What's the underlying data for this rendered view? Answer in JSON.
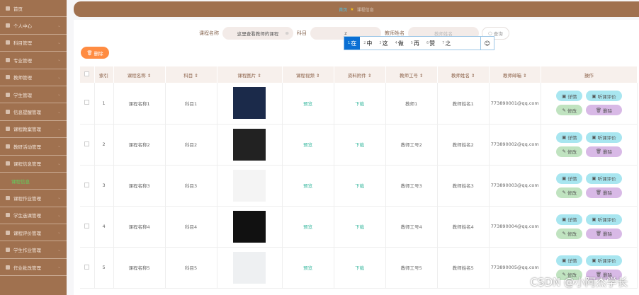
{
  "sidebar": {
    "items": [
      {
        "label": "首页"
      },
      {
        "label": "个人中心"
      },
      {
        "label": "科目管理"
      },
      {
        "label": "专业管理"
      },
      {
        "label": "教师管理"
      },
      {
        "label": "学生管理"
      },
      {
        "label": "信息提醒管理"
      },
      {
        "label": "课程教案管理"
      },
      {
        "label": "教研活动管理"
      },
      {
        "label": "课程信息管理"
      },
      {
        "label": "课程信息",
        "sub": true
      },
      {
        "label": "课程作业管理"
      },
      {
        "label": "学生选课管理"
      },
      {
        "label": "课程评价管理"
      },
      {
        "label": "学生作业管理"
      },
      {
        "label": "作业批改管理"
      }
    ]
  },
  "breadcrumb": {
    "home": "首页",
    "current": "课程信息"
  },
  "search": {
    "course_label": "课程名称",
    "course_value": "这里查看教师的课程",
    "subject_label": "科目",
    "subject_value": "z",
    "teacher_label": "教师姓名",
    "teacher_placeholder": "教师姓名",
    "query": "查询"
  },
  "ime": {
    "candidates": [
      "在",
      "中",
      "这",
      "做",
      "再",
      "赞",
      "之"
    ],
    "emoji": "☺"
  },
  "toolbar": {
    "delete": "删除"
  },
  "table": {
    "headers": [
      "索引",
      "课程名称",
      "科目",
      "课程图片",
      "课程视频",
      "资料附件",
      "教师工号",
      "教师姓名",
      "教师邮箱",
      "操作"
    ],
    "rows": [
      {
        "index": "1",
        "name": "课程名称1",
        "subject": "科目1",
        "video": "预览",
        "file": "下载",
        "tid": "教师1",
        "tname": "教师姓名1",
        "email": "773890001@qq.com"
      },
      {
        "index": "2",
        "name": "课程名称2",
        "subject": "科目2",
        "video": "预览",
        "file": "下载",
        "tid": "教师工号2",
        "tname": "教师姓名2",
        "email": "773890002@qq.com"
      },
      {
        "index": "3",
        "name": "课程名称3",
        "subject": "科目3",
        "video": "预览",
        "file": "下载",
        "tid": "教师工号3",
        "tname": "教师姓名3",
        "email": "773890003@qq.com"
      },
      {
        "index": "4",
        "name": "课程名称4",
        "subject": "科目4",
        "video": "预览",
        "file": "下载",
        "tid": "教师工号4",
        "tname": "教师姓名4",
        "email": "773890004@qq.com"
      },
      {
        "index": "5",
        "name": "课程名称5",
        "subject": "科目5",
        "video": "预览",
        "file": "下载",
        "tid": "教师工号5",
        "tname": "教师姓名5",
        "email": "773890005@qq.com"
      }
    ],
    "actions": {
      "detail": "详情",
      "review": "听课评价",
      "edit": "修改",
      "delete": "删除"
    }
  },
  "watermark": "CSDN @小阿杰学长"
}
